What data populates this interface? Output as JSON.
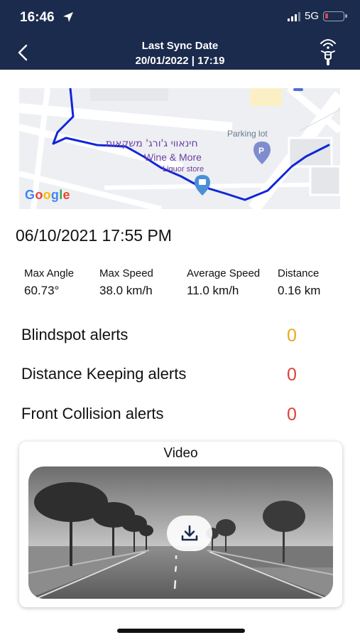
{
  "status_bar": {
    "time": "16:46",
    "network": "5G"
  },
  "header": {
    "title": "Last Sync Date",
    "sync_date": "20/01/2022 | 17:19",
    "background_color": "#1b2b4d"
  },
  "map": {
    "labels": {
      "shop_hebrew": "חינאווי ג'ורג' משקאות",
      "shop_name": "Wine & More",
      "shop_category": "Liquor store",
      "parking": "Parking lot",
      "attribution": "Google"
    },
    "route_color": "#1026d8"
  },
  "trip": {
    "datetime": "06/10/2021 17:55 PM",
    "stats": [
      {
        "label": "Max Angle",
        "value": "60.73°"
      },
      {
        "label": "Max Speed",
        "value": "38.0 km/h"
      },
      {
        "label": "Average Speed",
        "value": "11.0 km/h"
      },
      {
        "label": "Distance",
        "value": "0.16 km"
      }
    ]
  },
  "alerts": [
    {
      "label": "Blindspot alerts",
      "count": "0",
      "color": "#e8a91b"
    },
    {
      "label": "Distance Keeping alerts",
      "count": "0",
      "color": "#e0403a"
    },
    {
      "label": "Front Collision alerts",
      "count": "0",
      "color": "#e0403a"
    }
  ],
  "video": {
    "title": "Video",
    "download_icon": "download-icon"
  }
}
